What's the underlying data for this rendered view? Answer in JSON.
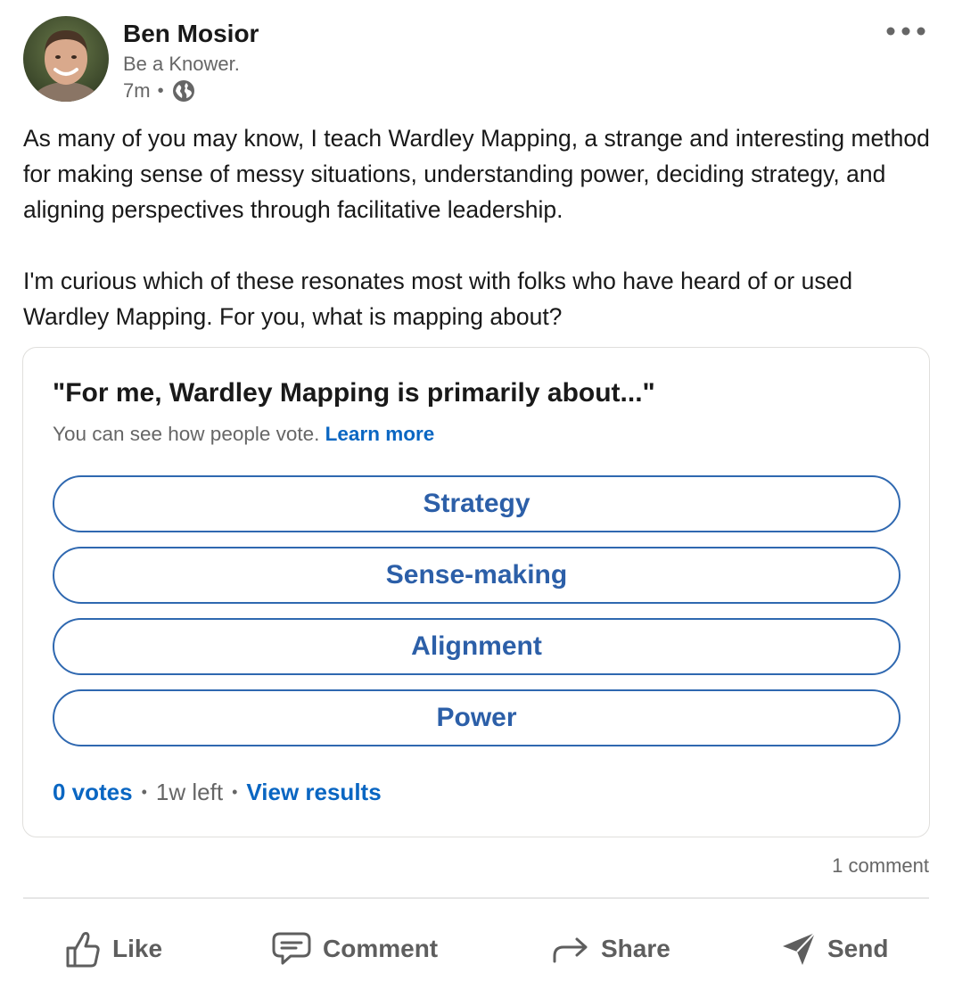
{
  "author": {
    "name": "Ben Mosior",
    "headline": "Be a Knower.",
    "time": "7m",
    "visibility_icon": "globe-icon"
  },
  "post": {
    "paragraph_1": "As many of you may know, I teach Wardley Mapping, a strange and interesting method for making sense of messy situations, understanding power, deciding strategy, and aligning perspectives through facilitative leadership.",
    "paragraph_2": "I'm curious which of these resonates most with folks who have heard of or used Wardley Mapping. For you, what is mapping about?"
  },
  "poll": {
    "question": "\"For me, Wardley Mapping is primarily about...\"",
    "note": "You can see how people vote.",
    "learn_more": "Learn more",
    "options": [
      "Strategy",
      "Sense-making",
      "Alignment",
      "Power"
    ],
    "votes": "0 votes",
    "time_left": "1w left",
    "view_results": "View results"
  },
  "social": {
    "comment_count": "1 comment"
  },
  "actions": {
    "like": "Like",
    "comment": "Comment",
    "share": "Share",
    "send": "Send"
  },
  "colors": {
    "link_blue": "#0a66c2",
    "option_border": "#2f68b0",
    "muted_text": "#666666"
  }
}
